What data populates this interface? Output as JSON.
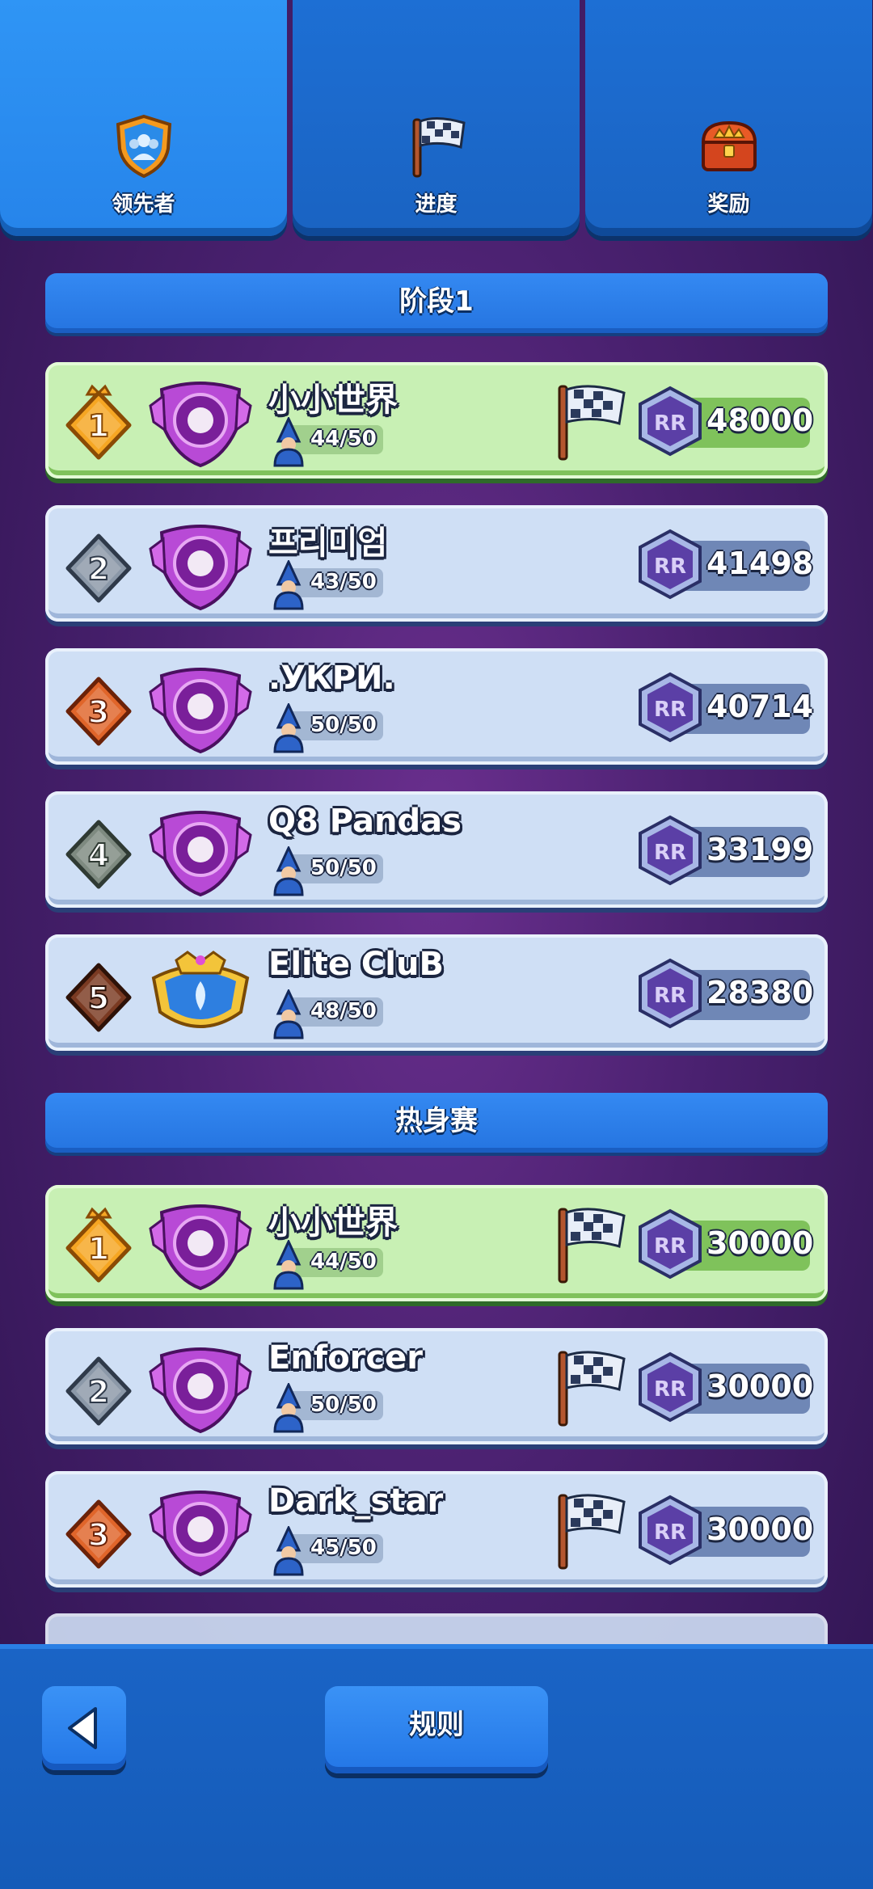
{
  "tabs": [
    {
      "label": "领先者",
      "icon": "shield-members-icon",
      "active": true
    },
    {
      "label": "进度",
      "icon": "checkered-flag-icon",
      "active": false
    },
    {
      "label": "奖励",
      "icon": "treasure-chest-icon",
      "active": false
    }
  ],
  "sections": [
    {
      "title": "阶段1",
      "rows": [
        {
          "rank": "1",
          "name": "小小世界",
          "members": "44/50",
          "score": "48000",
          "flag": true,
          "leader": true,
          "badge": "swords-badge-icon"
        },
        {
          "rank": "2",
          "name": "프리미엄",
          "members": "43/50",
          "score": "41498",
          "flag": false,
          "leader": false,
          "badge": "clover-badge-icon"
        },
        {
          "rank": "3",
          "name": ".УКРИ.",
          "members": "50/50",
          "score": "40714",
          "flag": false,
          "leader": false,
          "badge": "card-badge-icon"
        },
        {
          "rank": "4",
          "name": "Q8 Pandas",
          "members": "50/50",
          "score": "33199",
          "flag": false,
          "leader": false,
          "badge": "bear-badge-icon"
        },
        {
          "rank": "5",
          "name": "Elite CluB",
          "members": "48/50",
          "score": "28380",
          "flag": false,
          "leader": false,
          "badge": "crown-badge-icon"
        }
      ]
    },
    {
      "title": "热身赛",
      "rows": [
        {
          "rank": "1",
          "name": "小小世界",
          "members": "44/50",
          "score": "30000",
          "flag": true,
          "leader": true,
          "badge": "swords-badge-icon"
        },
        {
          "rank": "2",
          "name": "Enforcer",
          "members": "50/50",
          "score": "30000",
          "flag": true,
          "leader": false,
          "badge": "card-badge-icon"
        },
        {
          "rank": "3",
          "name": "Dark_star",
          "members": "45/50",
          "score": "30000",
          "flag": true,
          "leader": false,
          "badge": "bull-badge-icon"
        }
      ]
    }
  ],
  "score_icon": "RR",
  "bottom": {
    "back_icon": "back-arrow-icon",
    "rules_label": "规则"
  },
  "colors": {
    "accent": "#2684ea",
    "leader_row": "#c8f0b4",
    "row": "#cfdff5",
    "background": "#4a2170"
  }
}
